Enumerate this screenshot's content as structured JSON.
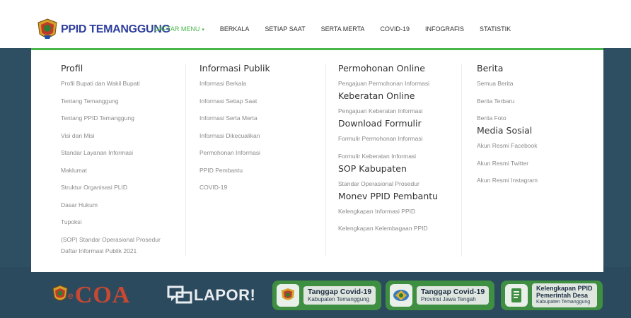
{
  "header": {
    "logo_text": "PPID TEMANGGUNG",
    "nav": [
      {
        "label": "DAFTAR MENU",
        "active": true,
        "caret": "▾"
      },
      {
        "label": "BERKALA"
      },
      {
        "label": "SETIAP SAAT"
      },
      {
        "label": "SERTA MERTA"
      },
      {
        "label": "COVID-19"
      },
      {
        "label": "INFOGRAFIS"
      },
      {
        "label": "STATISTIK"
      }
    ]
  },
  "menu": {
    "profil": {
      "heading": "Profil",
      "links": [
        "Profil Bupati dan Wakil Bupati",
        "Tentang Temanggung",
        "Tentang PPID Temanggung",
        "Visi dan Misi",
        "Standar Layanan Informasi",
        "Maklumat",
        "Struktur Organisasi PLID",
        "Dasar Hukum",
        "Tupoksi",
        "(SOP) Standar Operasional Prosedur",
        "Daftar Informasi Publik 2021"
      ]
    },
    "informasi": {
      "heading": "Informasi Publik",
      "links": [
        "Informasi Berkala",
        "Informasi Setiap Saat",
        "Informasi Serta Merta",
        "Informasi Dikecualikan",
        "Permohonan Informasi",
        "PPID Pembantu",
        "COVID-19"
      ]
    },
    "permohonan": {
      "heading": "Permohonan Online",
      "link1": "Pengajuan Permohonan Informasi",
      "sub1": "Keberatan Online",
      "link2": "Pengajuan Keberatan Informasi",
      "sub2": "Download Formulir",
      "link3": "Formulir Permohonan Informasi",
      "link4": "Formulir Keberatan Informasi",
      "sub3": "SOP Kabupaten",
      "link5": "Standar Operasional Prosedur",
      "sub4": "Monev PPID Pembantu",
      "link6": "Kelengkapan Informasi PPID",
      "link7": "Kelengkapan Kelembagaan PPID"
    },
    "berita": {
      "heading": "Berita",
      "link1": "Semua Berita",
      "link2": "Berita Terbaru",
      "link3": "Berita Foto",
      "sub1": "Media Sosial",
      "link4": "Akun Resmi Facebook",
      "link5": "Akun Resmi Twitter",
      "link6": "Akun Resmi Instagram"
    }
  },
  "banners": {
    "ecoa_e": "e",
    "ecoa": "COA",
    "lapor": "LAPOR!",
    "covid_kab_title": "Tanggap Covid-19",
    "covid_kab_sub": "Kabupaten Temanggung",
    "covid_prov_title": "Tanggap Covid-19",
    "covid_prov_sub": "Provinsi Jawa Tengah",
    "ppid_desa_title1": "Kelengkapan PPID",
    "ppid_desa_title2": "Pemerintah Desa",
    "ppid_desa_sub": "Kabupaten Temanggung"
  },
  "colors": {
    "accent_green": "#48b648",
    "logo_blue": "#2f3f9e",
    "band": "#2e4e62"
  }
}
